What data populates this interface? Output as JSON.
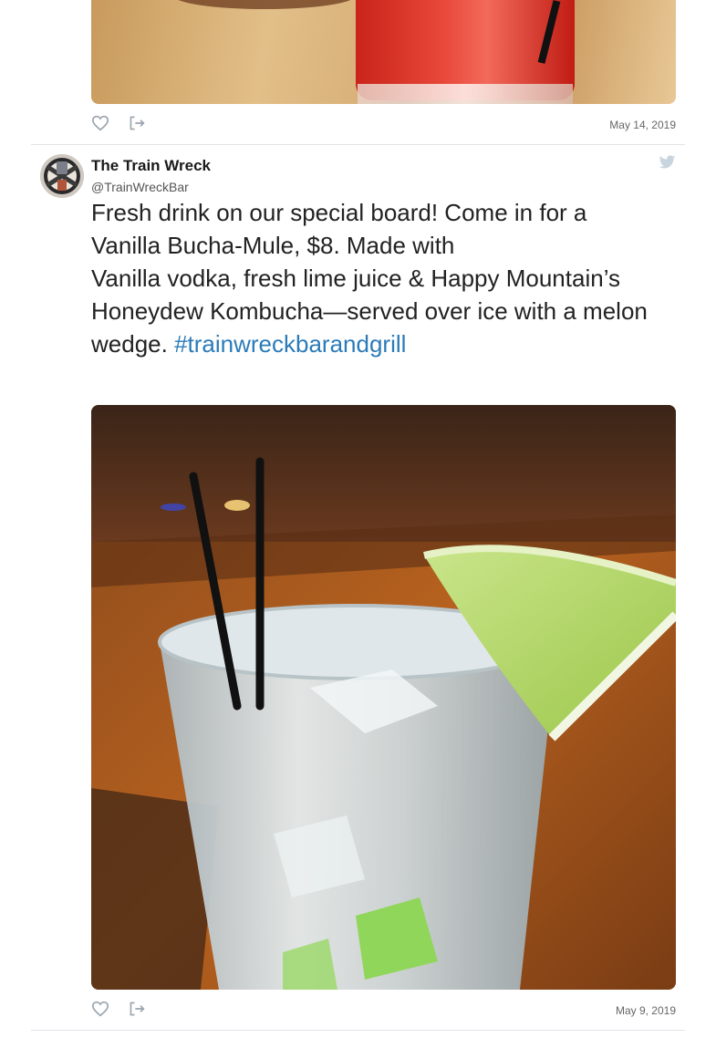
{
  "previous_tweet": {
    "date": "May 14, 2019",
    "photo_alt": "red drink on wooden bar"
  },
  "tweet": {
    "author_name": "The Train Wreck",
    "author_handle": "@TrainWreckBar",
    "text_line1": "Fresh drink on our special board! Come in for a",
    "text_line2": "Vanilla Bucha-Mule, $8. Made with",
    "text_line3": "Vanilla vodka, fresh lime juice & Happy Mountain’s",
    "text_line4": "Honeydew Kombucha—served over ice with a melon",
    "text_line5_start": "wedge. ",
    "hashtag": "#trainwreckbarandgrill",
    "date": "May 9, 2019"
  },
  "icons": {
    "like": "heart-icon",
    "share": "share-icon",
    "platform": "twitter-bird-icon"
  },
  "colors": {
    "link": "#2b7bb9",
    "icon": "#9aa4ad",
    "divider": "#e1e4e8"
  }
}
